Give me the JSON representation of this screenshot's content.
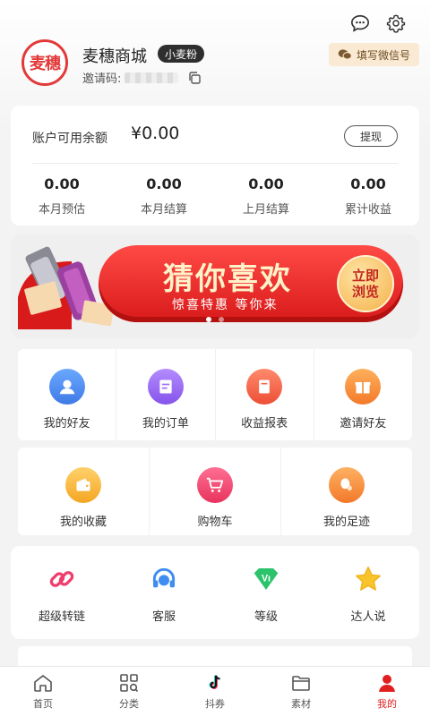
{
  "header": {
    "shop_name": "麦穗商城",
    "logo_text": "麦穗",
    "badge": "小麦粉",
    "invite_label": "邀请码:",
    "wechat_button": "填写微信号"
  },
  "balance": {
    "label": "账户可用余额",
    "amount": "¥0.00",
    "withdraw_label": "提现",
    "stats": [
      {
        "value": "0.00",
        "label": "本月预估"
      },
      {
        "value": "0.00",
        "label": "本月结算"
      },
      {
        "value": "0.00",
        "label": "上月结算"
      },
      {
        "value": "0.00",
        "label": "累计收益"
      }
    ]
  },
  "banner": {
    "title": "猜你喜欢",
    "subtitle": "惊喜特惠 等你来",
    "cta": "立即浏览",
    "slides": 2,
    "active_slide": 1
  },
  "grid1": [
    {
      "label": "我的好友",
      "icon": "friends-icon",
      "color": "#4e8df5"
    },
    {
      "label": "我的订单",
      "icon": "order-icon",
      "color": "#9b6cf0"
    },
    {
      "label": "收益报表",
      "icon": "report-icon",
      "color": "#f36a4b"
    },
    {
      "label": "邀请好友",
      "icon": "gift-icon",
      "color": "#f5913d"
    }
  ],
  "grid2": [
    {
      "label": "我的收藏",
      "icon": "wallet-icon",
      "color": "#f7b23b"
    },
    {
      "label": "购物车",
      "icon": "cart-icon",
      "color": "#ef4c74"
    },
    {
      "label": "我的足迹",
      "icon": "footprint-icon",
      "color": "#f5933e"
    }
  ],
  "tools": [
    {
      "label": "超级转链",
      "icon": "link-icon"
    },
    {
      "label": "客服",
      "icon": "headset-icon"
    },
    {
      "label": "等级",
      "icon": "vip-icon"
    },
    {
      "label": "达人说",
      "icon": "star-icon"
    }
  ],
  "nav": [
    {
      "label": "首页",
      "icon": "home-icon"
    },
    {
      "label": "分类",
      "icon": "category-icon"
    },
    {
      "label": "抖券",
      "icon": "tiktok-icon"
    },
    {
      "label": "素材",
      "icon": "folder-icon"
    },
    {
      "label": "我的",
      "icon": "profile-icon",
      "active": true
    }
  ],
  "colors": {
    "accent": "#e02020",
    "badge_bg": "#2e2e2e",
    "wechat_bg": "#fbead3"
  }
}
